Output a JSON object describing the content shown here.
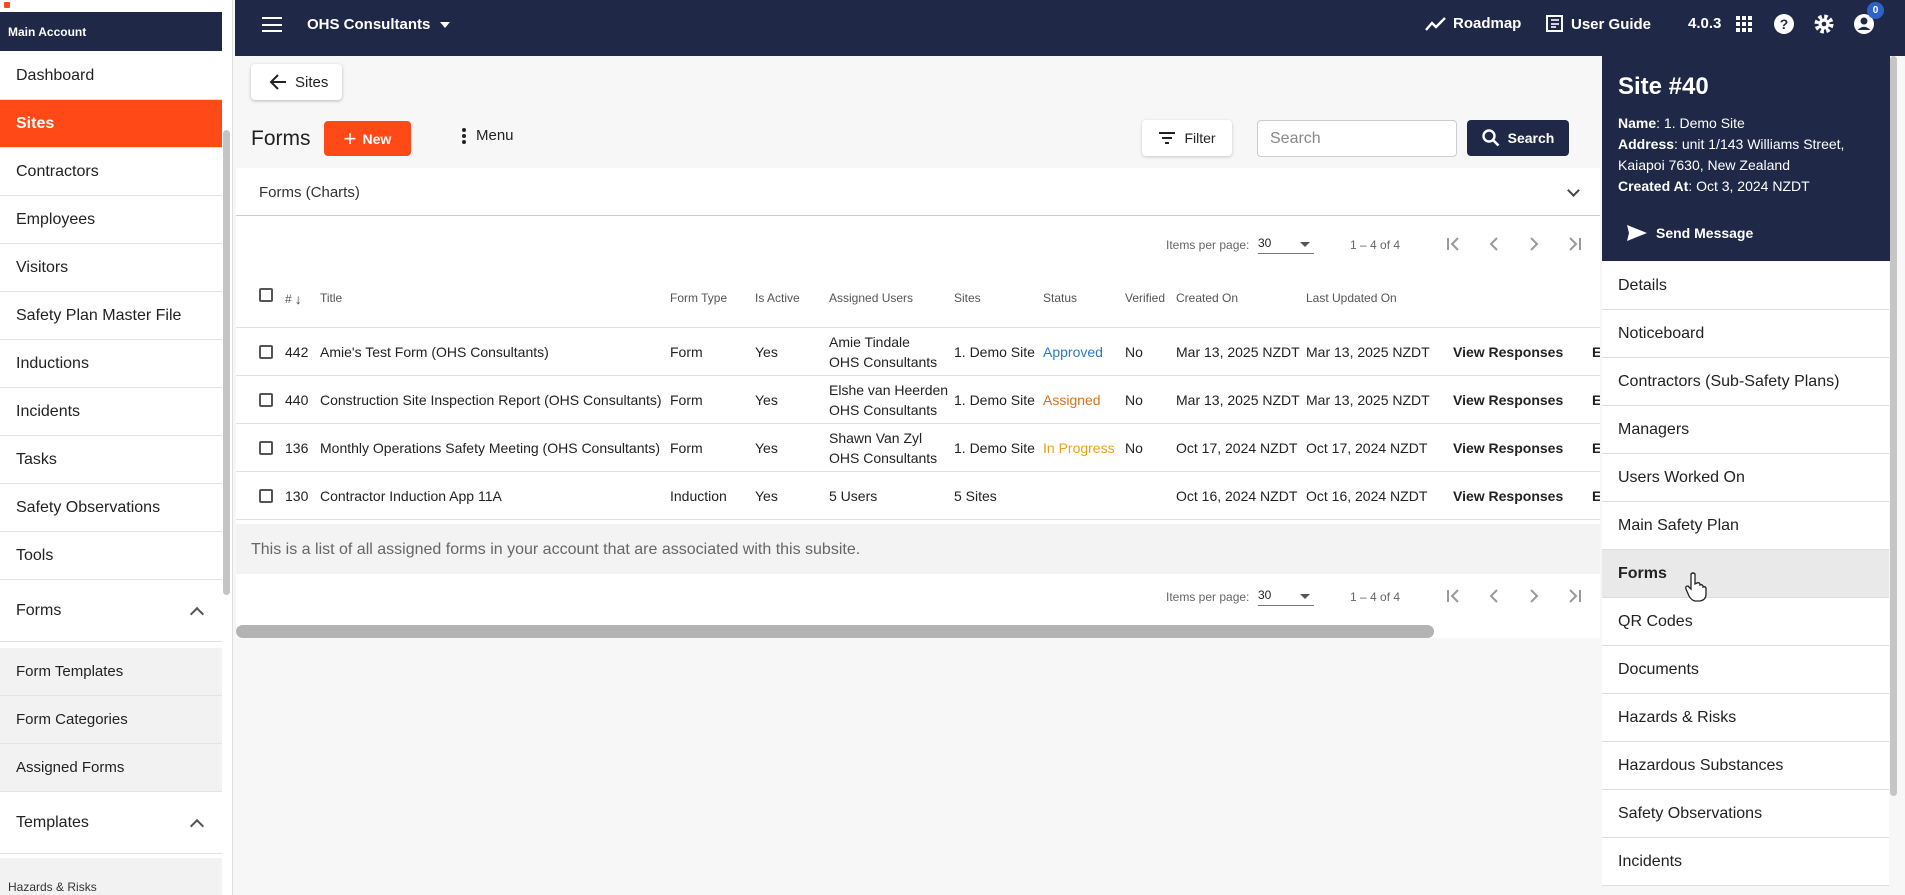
{
  "sidebar": {
    "header": "Main Account",
    "items": [
      {
        "label": "Dashboard"
      },
      {
        "label": "Sites",
        "active": true
      },
      {
        "label": "Contractors"
      },
      {
        "label": "Employees"
      },
      {
        "label": "Visitors"
      },
      {
        "label": "Safety Plan Master File"
      },
      {
        "label": "Inductions"
      },
      {
        "label": "Incidents"
      },
      {
        "label": "Tasks"
      },
      {
        "label": "Safety Observations"
      },
      {
        "label": "Tools"
      }
    ],
    "forms_group": {
      "label": "Forms",
      "children": [
        "Form Templates",
        "Form Categories",
        "Assigned Forms"
      ]
    },
    "templates_group": {
      "label": "Templates",
      "children": [
        "Hazards & Risks"
      ]
    }
  },
  "topbar": {
    "org_name": "OHS Consultants",
    "roadmap": "Roadmap",
    "user_guide": "User Guide",
    "version": "4.0.3",
    "notification_count": "0"
  },
  "toolbar": {
    "back_label": "Sites",
    "title": "Forms",
    "new_label": "New",
    "menu_label": "Menu",
    "filter_label": "Filter",
    "search_placeholder": "Search",
    "search_label": "Search"
  },
  "charts_panel": {
    "label": "Forms (Charts)"
  },
  "pagination": {
    "items_per_page_label": "Items per page:",
    "items_per_page": "30",
    "range": "1 – 4 of 4"
  },
  "table": {
    "columns": [
      "#",
      "Title",
      "Form Type",
      "Is Active",
      "Assigned Users",
      "Sites",
      "Status",
      "Verified",
      "Created On",
      "Last Updated On"
    ],
    "rows": [
      {
        "id": "442",
        "title": "Amie's Test Form (OHS Consultants)",
        "form_type": "Form",
        "is_active": "Yes",
        "user_1": "Amie Tindale",
        "user_2": "OHS Consultants",
        "sites": "1. Demo Site",
        "status": "Approved",
        "verified": "No",
        "created": "Mar 13, 2025 NZDT",
        "updated": "Mar 13, 2025 NZDT",
        "action": "View Responses",
        "extra": "E"
      },
      {
        "id": "440",
        "title": "Construction Site Inspection Report (OHS Consultants)",
        "form_type": "Form",
        "is_active": "Yes",
        "user_1": "Elshe van Heerden",
        "user_2": "OHS Consultants",
        "sites": "1. Demo Site",
        "status": "Assigned",
        "verified": "No",
        "created": "Mar 13, 2025 NZDT",
        "updated": "Mar 13, 2025 NZDT",
        "action": "View Responses",
        "extra": "E"
      },
      {
        "id": "136",
        "title": "Monthly Operations Safety Meeting (OHS Consultants)",
        "form_type": "Form",
        "is_active": "Yes",
        "user_1": "Shawn Van Zyl",
        "user_2": "OHS Consultants",
        "sites": "1. Demo Site",
        "status": "In Progress",
        "verified": "No",
        "created": "Oct 17, 2024 NZDT",
        "updated": "Oct 17, 2024 NZDT",
        "action": "View Responses",
        "extra": "E"
      },
      {
        "id": "130",
        "title": "Contractor Induction App 11A",
        "form_type": "Induction",
        "is_active": "Yes",
        "user_1": "5 Users",
        "user_2": "",
        "sites": "5 Sites",
        "status": "",
        "verified": "",
        "created": "Oct 16, 2024 NZDT",
        "updated": "Oct 16, 2024 NZDT",
        "action": "View Responses",
        "extra": "E"
      }
    ],
    "footnote": "This is a list of all assigned forms in your account that are associated with this subsite."
  },
  "status_colors": {
    "Approved": "#2b7bc0",
    "Assigned": "#d9731a",
    "In Progress": "#e8a317"
  },
  "site_panel": {
    "title": "Site #40",
    "name_label": "Name",
    "name": "1. Demo Site",
    "address_label": "Address",
    "address_line_1": "unit 1/143 Williams Street,",
    "address_line_2": "Kaiapoi 7630, New Zealand",
    "created_label": "Created At",
    "created": "Oct 3, 2024 NZDT",
    "send_message": "Send Message",
    "menu": [
      "Details",
      "Noticeboard",
      "Contractors (Sub-Safety Plans)",
      "Managers",
      "Users Worked On",
      "Main Safety Plan",
      "Forms",
      "QR Codes",
      "Documents",
      "Hazards & Risks",
      "Hazardous Substances",
      "Safety Observations",
      "Incidents"
    ],
    "active_item": "Forms"
  }
}
